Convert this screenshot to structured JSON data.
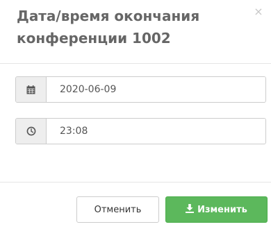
{
  "dialog": {
    "title": "Дата/время окончания конференции 1002",
    "close_label": "×"
  },
  "form": {
    "date_value": "2020-06-09",
    "time_value": "23:08",
    "date_icon": "calendar-icon",
    "time_icon": "clock-icon"
  },
  "footer": {
    "cancel_label": "Отменить",
    "submit_label": "Изменить",
    "submit_icon": "download-icon"
  },
  "colors": {
    "submit_bg": "#5cb85c",
    "addon_bg": "#eeeeee",
    "title_text": "#666666"
  }
}
